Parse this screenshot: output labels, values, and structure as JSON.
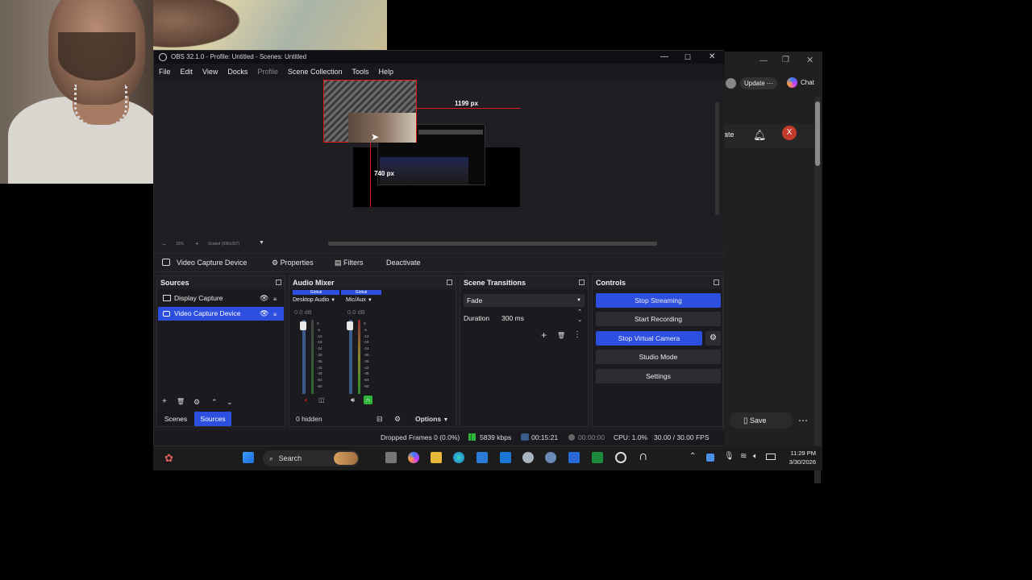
{
  "obs": {
    "title": "OBS 32.1.0 - Profile: Untitled - Scenes: Untitled",
    "menu": [
      "File",
      "Edit",
      "View",
      "Docks",
      "Profile",
      "Scene Collection",
      "Tools",
      "Help"
    ],
    "preview": {
      "width_label": "1199 px",
      "height_label": "740 px",
      "zoom_value": "33%",
      "scale_label": "Scaled (636x357)"
    },
    "source_toolbar": {
      "source_name": "Video Capture Device",
      "properties": "Properties",
      "filters": "Filters",
      "deactivate": "Deactivate"
    },
    "sources": {
      "title": "Sources",
      "items": [
        {
          "label": "Display Capture",
          "selected": false
        },
        {
          "label": "Video Capture Device",
          "selected": true
        }
      ],
      "tabs": [
        {
          "label": "Scenes",
          "active": false
        },
        {
          "label": "Sources",
          "active": true
        }
      ]
    },
    "audio_mixer": {
      "title": "Audio Mixer",
      "channels": [
        {
          "tag": "Global",
          "name": "Desktop Audio",
          "level": "0.0 dB",
          "fader_level": 1.0
        },
        {
          "tag": "Global",
          "name": "Mic/Aux",
          "level": "0.0 dB",
          "fader_level": 1.0
        }
      ],
      "scale": [
        "0",
        "-6",
        "-12",
        "-18",
        "-24",
        "-30",
        "-36",
        "-42",
        "-48",
        "-54",
        "-60"
      ],
      "hidden": "0 hidden",
      "options": "Options"
    },
    "transitions": {
      "title": "Scene Transitions",
      "selected": "Fade",
      "duration_label": "Duration",
      "duration_value": "300 ms"
    },
    "controls": {
      "title": "Controls",
      "buttons": [
        {
          "label": "Stop Streaming",
          "active": true
        },
        {
          "label": "Start Recording",
          "active": false
        },
        {
          "label": "Stop Virtual Camera",
          "active": true
        },
        {
          "label": "Studio Mode",
          "active": false
        },
        {
          "label": "Settings",
          "active": false
        }
      ]
    },
    "status": {
      "dropped_frames": "Dropped Frames 0 (0.0%)",
      "bitrate": "5839 kbps",
      "stream_time": "00:15:21",
      "record_time": "00:00:00",
      "cpu": "CPU: 1.0%",
      "fps": "30.00 / 30.00 FPS"
    }
  },
  "browser": {
    "update_label": "Update",
    "chat_label": "Chat",
    "partial_text": "ate",
    "avatar_letter": "X",
    "save_label": "Save"
  },
  "taskbar": {
    "search_label": "Search",
    "time": "11:29 PM",
    "date": "3/30/2026"
  },
  "colors": {
    "accent_blue": "#2c4fe0",
    "selection": "#2c4fe0",
    "bounding_red": "#e01818",
    "stream_green": "#2fb43a"
  }
}
